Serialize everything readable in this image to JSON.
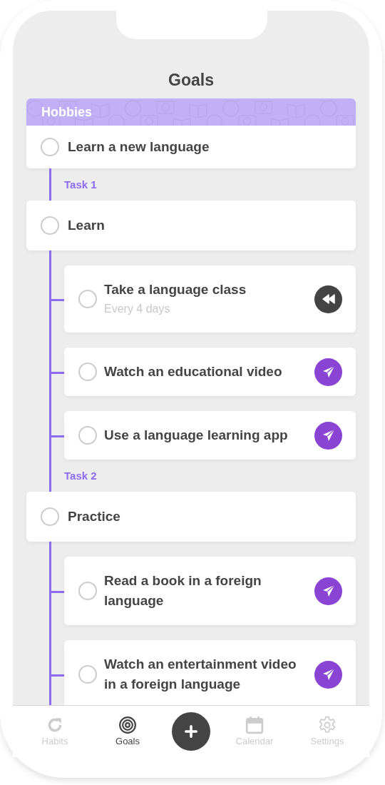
{
  "title": "Goals",
  "goal": {
    "category": "Hobbies",
    "name": "Learn a new language",
    "checked": false
  },
  "tasks": [
    {
      "label": "Task 1",
      "name": "Learn",
      "checked": false,
      "subtasks": [
        {
          "name": "Take a language class",
          "note": "Every 4 days",
          "checked": false,
          "kind": "rewind"
        },
        {
          "name": "Watch an educational video",
          "checked": false,
          "kind": "send"
        },
        {
          "name": "Use a language learning app",
          "checked": false,
          "kind": "send"
        }
      ]
    },
    {
      "label": "Task 2",
      "name": "Practice",
      "checked": false,
      "subtasks": [
        {
          "name": "Read a book in a foreign language",
          "checked": false,
          "kind": "send"
        },
        {
          "name": "Watch an entertainment video in a foreign language",
          "checked": false,
          "kind": "send"
        }
      ]
    }
  ],
  "nav": [
    {
      "kind": "habits",
      "label": "Habits",
      "selected": false
    },
    {
      "kind": "goals",
      "label": "Goals",
      "selected": true
    },
    {
      "kind": "add"
    },
    {
      "kind": "calendar",
      "label": "Calendar",
      "selected": false
    },
    {
      "kind": "settings",
      "label": "Settings",
      "selected": false
    }
  ]
}
